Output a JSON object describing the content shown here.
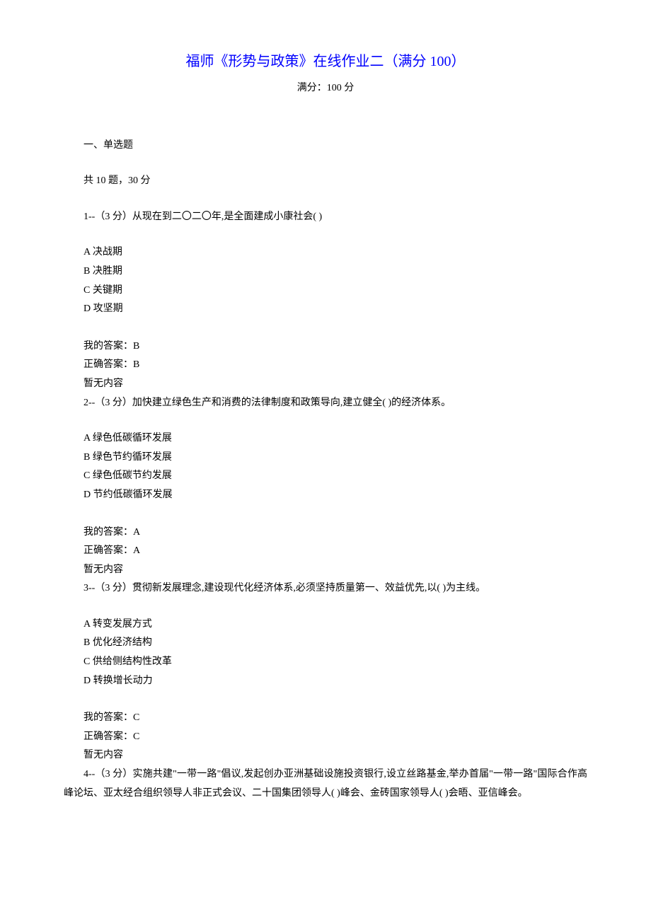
{
  "title": "福师《形势与政策》在线作业二（满分 100）",
  "subtitle": "满分：100 分",
  "section": {
    "header": "一、单选题",
    "sub": "共 10 题，30 分"
  },
  "q1": {
    "stem": "1--（3 分）从现在到二〇二〇年,是全面建成小康社会( )",
    "a": "A 决战期",
    "b": "B 决胜期",
    "c": "C 关键期",
    "d": "D 攻坚期",
    "my": "我的答案：B",
    "correct": "正确答案：B",
    "note": "暂无内容"
  },
  "q2": {
    "stem": "2--（3 分）加快建立绿色生产和消费的法律制度和政策导向,建立健全( )的经济体系。",
    "a": "A 绿色低碳循环发展",
    "b": "B 绿色节约循环发展",
    "c": "C 绿色低碳节约发展",
    "d": "D 节约低碳循环发展",
    "my": "我的答案：A",
    "correct": "正确答案：A",
    "note": "暂无内容"
  },
  "q3": {
    "stem": "3--（3 分）贯彻新发展理念,建设现代化经济体系,必须坚持质量第一、效益优先,以( )为主线。",
    "a": "A 转变发展方式",
    "b": "B 优化经济结构",
    "c": "C 供给侧结构性改革",
    "d": "D 转换增长动力",
    "my": "我的答案：C",
    "correct": "正确答案：C",
    "note": "暂无内容"
  },
  "q4": {
    "stem": "4--（3 分）实施共建\"一带一路\"倡议,发起创办亚洲基础设施投资银行,设立丝路基金,举办首届\"一带一路\"国际合作高峰论坛、亚太经合组织领导人非正式会议、二十国集团领导人( )峰会、金砖国家领导人( )会晤、亚信峰会。"
  }
}
